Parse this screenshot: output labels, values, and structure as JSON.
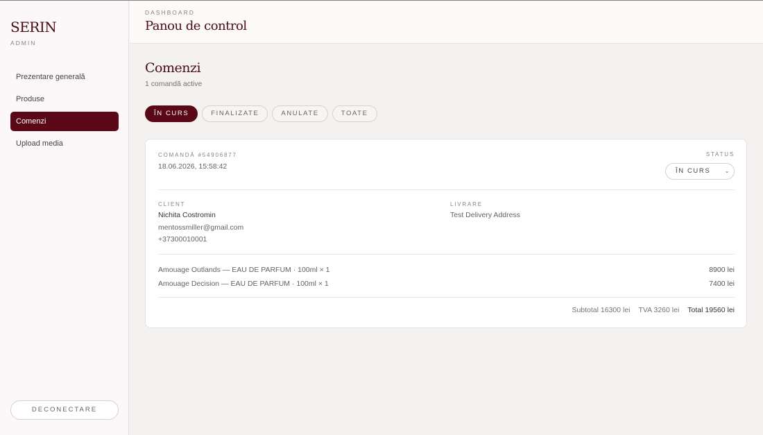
{
  "sidebar": {
    "brand": "SERIN",
    "brand_sub": "ADMIN",
    "items": [
      {
        "label": "Prezentare generală"
      },
      {
        "label": "Produse"
      },
      {
        "label": "Comenzi"
      },
      {
        "label": "Upload media"
      }
    ],
    "active_index": 2,
    "logout_label": "DECONECTARE"
  },
  "header": {
    "breadcrumb": "DASHBOARD",
    "title": "Panou de control"
  },
  "main": {
    "title": "Comenzi",
    "subtitle": "1 comandă active",
    "tabs": [
      {
        "label": "ÎN CURS"
      },
      {
        "label": "FINALIZATE"
      },
      {
        "label": "ANULATE"
      },
      {
        "label": "TOATE"
      }
    ],
    "active_tab": 0
  },
  "order": {
    "number_label": "COMANDĂ #54906877",
    "datetime": "18.06.2026, 15:58:42",
    "status_label": "STATUS",
    "status_value": "ÎN CURS",
    "client_label": "CLIENT",
    "client_name": "Nichita Costromin",
    "client_email": "mentossmiller@gmail.com",
    "client_phone": "+37300010001",
    "delivery_label": "LIVRARE",
    "delivery_address": "Test Delivery Address",
    "items": [
      {
        "name": "Amouage Outlands — EAU DE PARFUM · 100ml × 1",
        "price": "8900 lei"
      },
      {
        "name": "Amouage Decision — EAU DE PARFUM · 100ml × 1",
        "price": "7400 lei"
      }
    ],
    "subtotal": "Subtotal 16300 lei",
    "tva": "TVA 3260 lei",
    "total": "Total 19560 lei"
  },
  "colors": {
    "accent": "#5a0818",
    "brand_text": "#4a0a17",
    "background": "#f4f2f1"
  },
  "icons": {
    "status_dropdown": "chevron-down-icon"
  }
}
